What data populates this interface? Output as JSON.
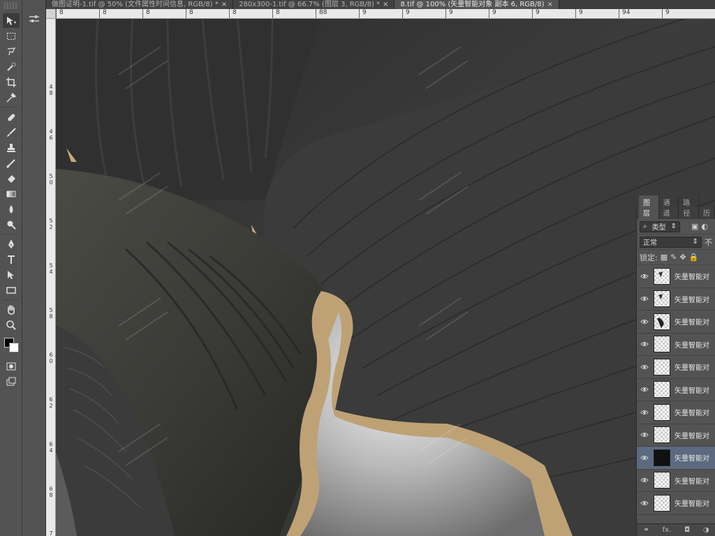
{
  "tabs": [
    {
      "label": "做图证明-1.tif @ 50% (文件属性时间信息, RGB/8) *",
      "active": false
    },
    {
      "label": "280x300-1.tif @ 66.7% (图层 3, RGB/8) *",
      "active": false
    },
    {
      "label": "8.tif @ 100% (矢量智能对象 副本 6, RGB/8)",
      "active": true
    }
  ],
  "rulers": {
    "horizontal": [
      "8",
      "",
      "8",
      "",
      "8",
      "",
      "8",
      "8",
      "",
      "8",
      "",
      "9",
      "",
      "9",
      "",
      "9"
    ],
    "horizontal_marks": [
      "8",
      "8",
      "8",
      "8",
      "8",
      "8",
      "88",
      "9",
      "9",
      "9",
      "9",
      "9",
      "9",
      "94",
      "9"
    ],
    "vertical": [
      "4",
      "8",
      "4",
      "6",
      "5",
      "0",
      "5",
      "2",
      "5",
      "4",
      "5",
      "8",
      "6",
      "0",
      "6",
      "2",
      "6",
      "4",
      "6",
      "8",
      "7",
      "0"
    ]
  },
  "tools": [
    "move-icon",
    "marquee-icon",
    "lasso-icon",
    "quick-select-icon",
    "crop-icon",
    "eyedropper-icon",
    "healing-icon",
    "brush-icon",
    "stamp-icon",
    "history-brush-icon",
    "eraser-icon",
    "gradient-icon",
    "blur-icon",
    "dodge-icon",
    "pen-icon",
    "type-icon",
    "path-select-icon",
    "shape-icon",
    "hand-icon",
    "zoom-icon"
  ],
  "layers_panel": {
    "tabs": [
      "图层",
      "通道",
      "路径",
      "历"
    ],
    "filter_label": "类型",
    "blend_mode": "正常",
    "opacity_label": "不",
    "lock_label": "锁定:",
    "layers": [
      {
        "name": "矢量智能对",
        "selected": false
      },
      {
        "name": "矢量智能对",
        "selected": false
      },
      {
        "name": "矢量智能对",
        "selected": false
      },
      {
        "name": "矢量智能对",
        "selected": false
      },
      {
        "name": "矢量智能对",
        "selected": false
      },
      {
        "name": "矢量智能对",
        "selected": false
      },
      {
        "name": "矢量智能对",
        "selected": false
      },
      {
        "name": "矢量智能对",
        "selected": false
      },
      {
        "name": "矢量智能对",
        "selected": true
      },
      {
        "name": "矢量智能对",
        "selected": false
      },
      {
        "name": "矢量智能对",
        "selected": false
      }
    ],
    "footer_icons": [
      "link-icon",
      "fx-icon",
      "mask-icon",
      "adjustment-icon"
    ],
    "footer_fx": "fx."
  },
  "colors": {
    "foreground": "#000000",
    "background": "#ffffff",
    "accent": "#5b6a80"
  }
}
